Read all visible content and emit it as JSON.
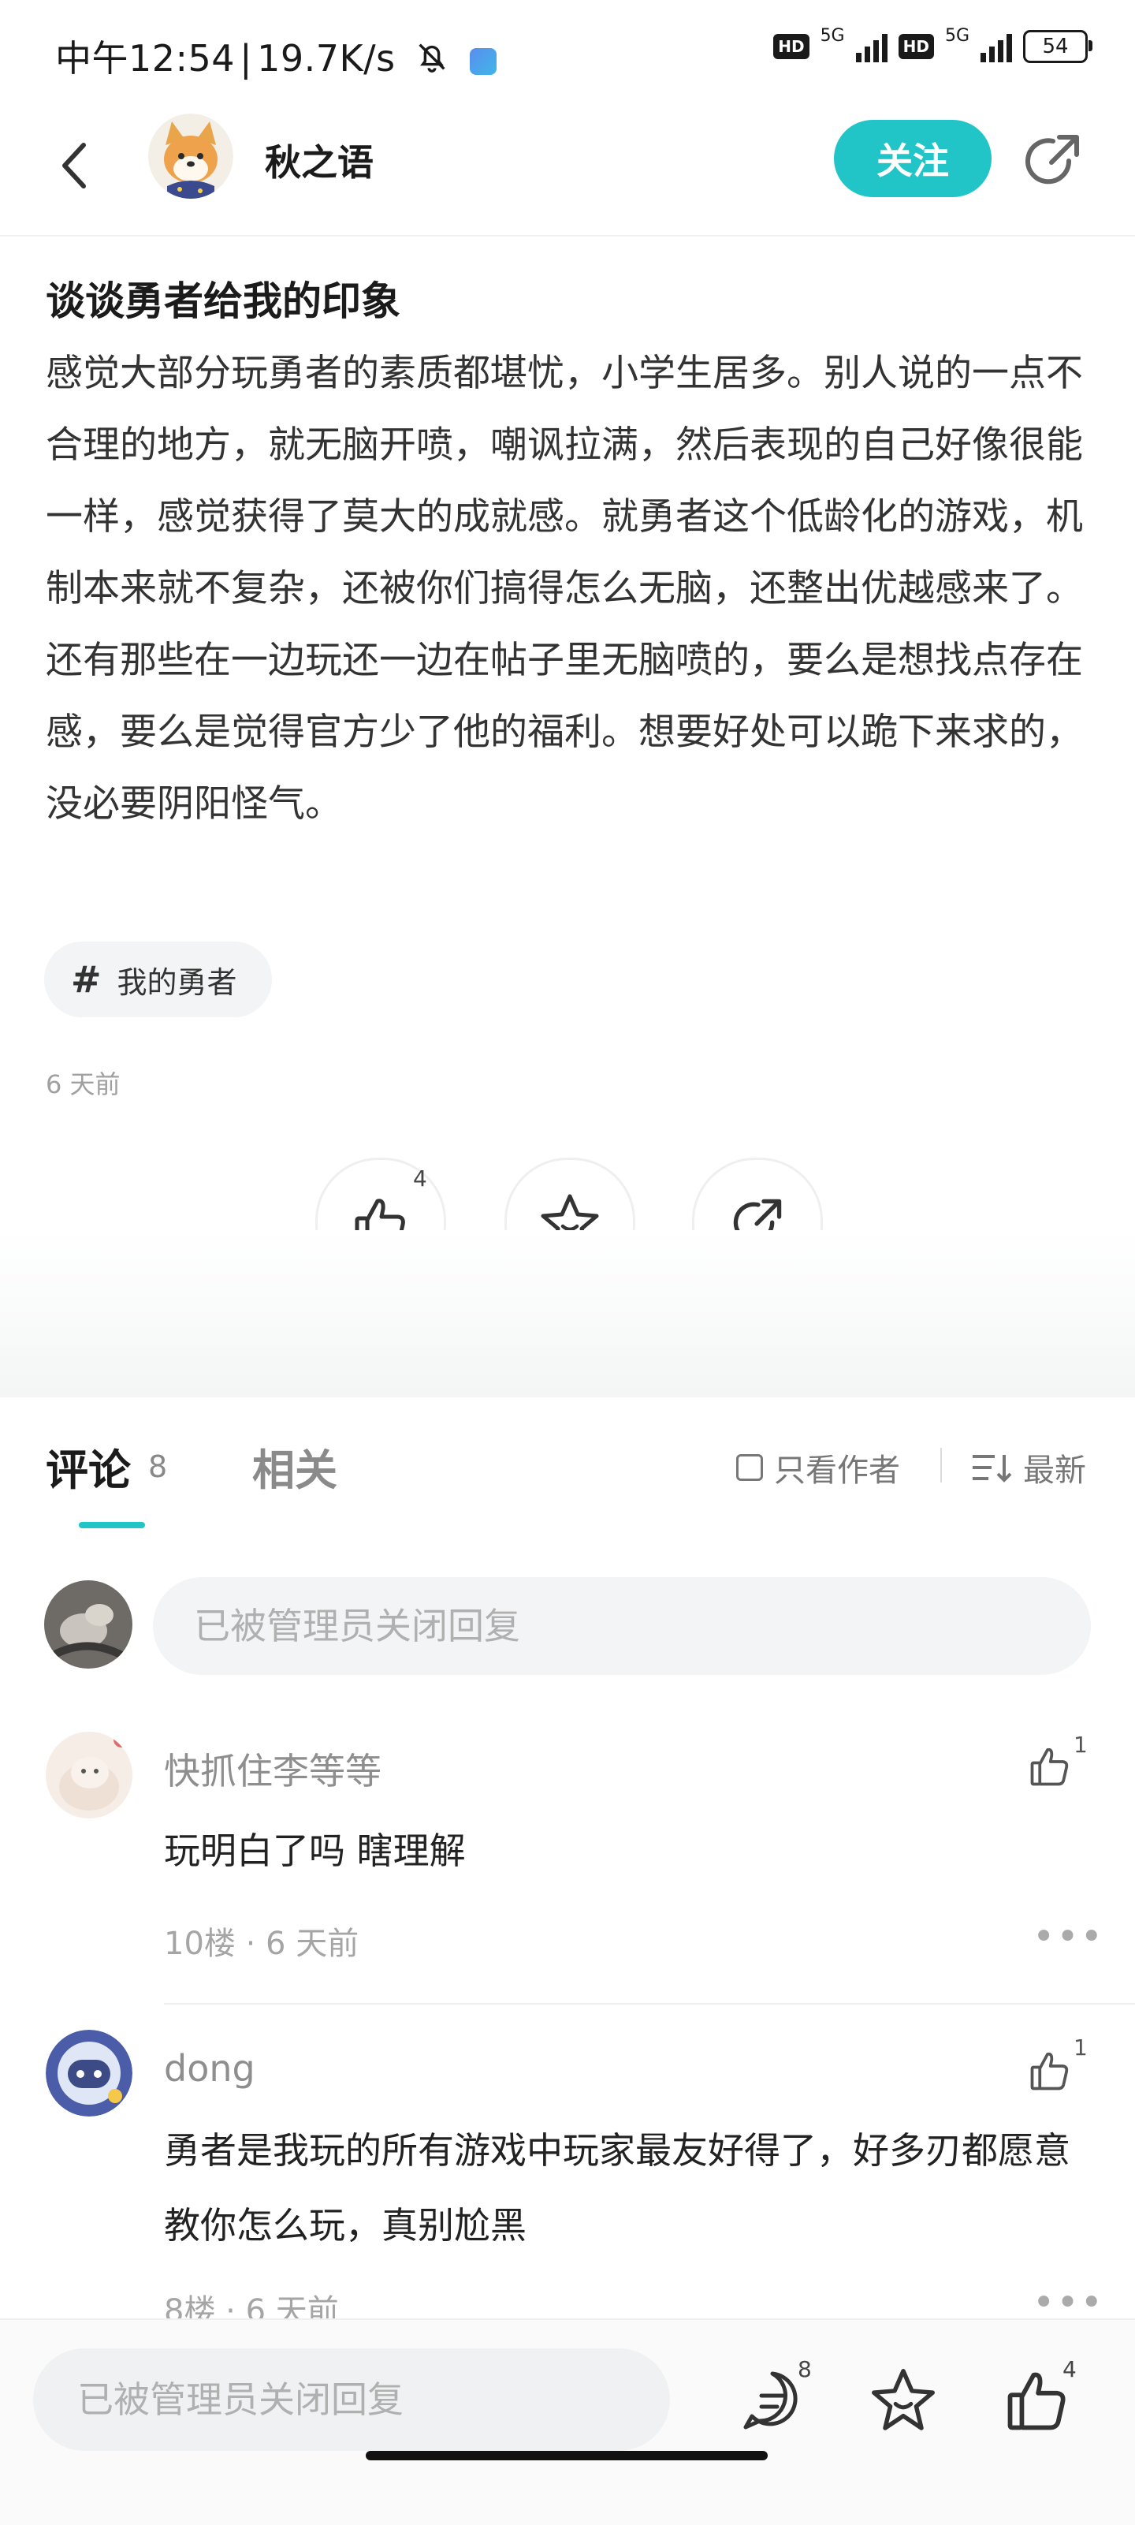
{
  "status_bar": {
    "time": "中午12:54",
    "speed": "19.7K/s",
    "hd1": "HD",
    "net1": "5G",
    "hd2": "HD",
    "net2": "5G",
    "battery": "54",
    "icons": [
      "mute-bell-icon",
      "app-notification-icon",
      "signal-icon",
      "battery-icon"
    ]
  },
  "header": {
    "author_name": "秋之语",
    "follow_label": "关注",
    "icons": [
      "back-icon",
      "share-icon"
    ]
  },
  "post": {
    "title": "谈谈勇者给我的印象",
    "body": "感觉大部分玩勇者的素质都堪忧，小学生居多。别人说的一点不合理的地方，就无脑开喷，嘲讽拉满，然后表现的自己好像很能一样，感觉获得了莫大的成就感。就勇者这个低龄化的游戏，机制本来就不复杂，还被你们搞得怎么无脑，还整出优越感来了。还有那些在一边玩还一边在帖子里无脑喷的，要么是想找点存在感，要么是觉得官方少了他的福利。想要好处可以跪下来求的，没必要阴阳怪气。",
    "tag": "我的勇者",
    "time": "6 天前",
    "like_count": "4"
  },
  "tabs": {
    "comments_label": "评论",
    "comments_count": "8",
    "related_label": "相关",
    "author_only": "只看作者",
    "sort": "最新"
  },
  "reply": {
    "placeholder": "已被管理员关闭回复"
  },
  "comments": [
    {
      "name": "快抓住李等等",
      "text": "玩明白了吗 瞎理解",
      "meta": "10楼 · 6 天前",
      "likes": "1"
    },
    {
      "name": "dong",
      "text": "勇者是我玩的所有游戏中玩家最友好得了，好多刃都愿意教你怎么玩，真别尬黑",
      "meta": "8楼 · 6 天前",
      "likes": "1"
    }
  ],
  "bottom_bar": {
    "placeholder": "已被管理员关闭回复",
    "comment_count": "8",
    "like_count": "4"
  },
  "colors": {
    "accent": "#22c5c7",
    "text_primary": "#222222",
    "text_muted": "#a0a0a0"
  }
}
